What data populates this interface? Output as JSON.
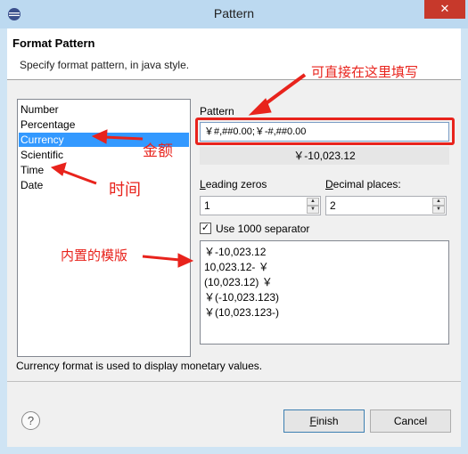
{
  "window": {
    "title": "Pattern",
    "close_glyph": "✕"
  },
  "header": {
    "title": "Format Pattern",
    "description": "Specify format pattern, in java style."
  },
  "categories": [
    {
      "label": "Number",
      "selected": false
    },
    {
      "label": "Percentage",
      "selected": false
    },
    {
      "label": "Currency",
      "selected": true
    },
    {
      "label": "Scientific",
      "selected": false
    },
    {
      "label": "Time",
      "selected": false
    },
    {
      "label": "Date",
      "selected": false
    }
  ],
  "pattern": {
    "label": "Pattern",
    "value": "￥#,##0.00;￥-#,##0.00",
    "preview": "￥-10,023.12"
  },
  "leading_zeros": {
    "label_pre": "",
    "mnemonic": "L",
    "label_post": "eading zeros",
    "value": "1"
  },
  "decimal_places": {
    "label_pre": "",
    "mnemonic": "D",
    "label_post": "ecimal places:",
    "value": "2"
  },
  "separator_option": {
    "label": "Use 1000 separator",
    "checked": true,
    "check_glyph": "✓"
  },
  "examples": [
    "￥-10,023.12",
    "10,023.12- ￥",
    "(10,023.12) ￥",
    "￥(-10,023.123)",
    "￥(10,023.123-)"
  ],
  "status_description": "Currency format is used to display monetary values.",
  "buttons": {
    "finish": {
      "mnemonic": "F",
      "rest": "inish"
    },
    "cancel": "Cancel",
    "help_glyph": "?"
  },
  "annotations": {
    "pattern_note": "可直接在这里填写",
    "currency_note": "金额",
    "time_note": "时间",
    "examples_note": "内置的模版"
  },
  "colors": {
    "accent": "#3399ff",
    "annotation": "#e8231c",
    "close": "#c7392b"
  },
  "icons": {
    "app": "eclipse-icon",
    "help": "help-icon",
    "close": "close-icon"
  }
}
